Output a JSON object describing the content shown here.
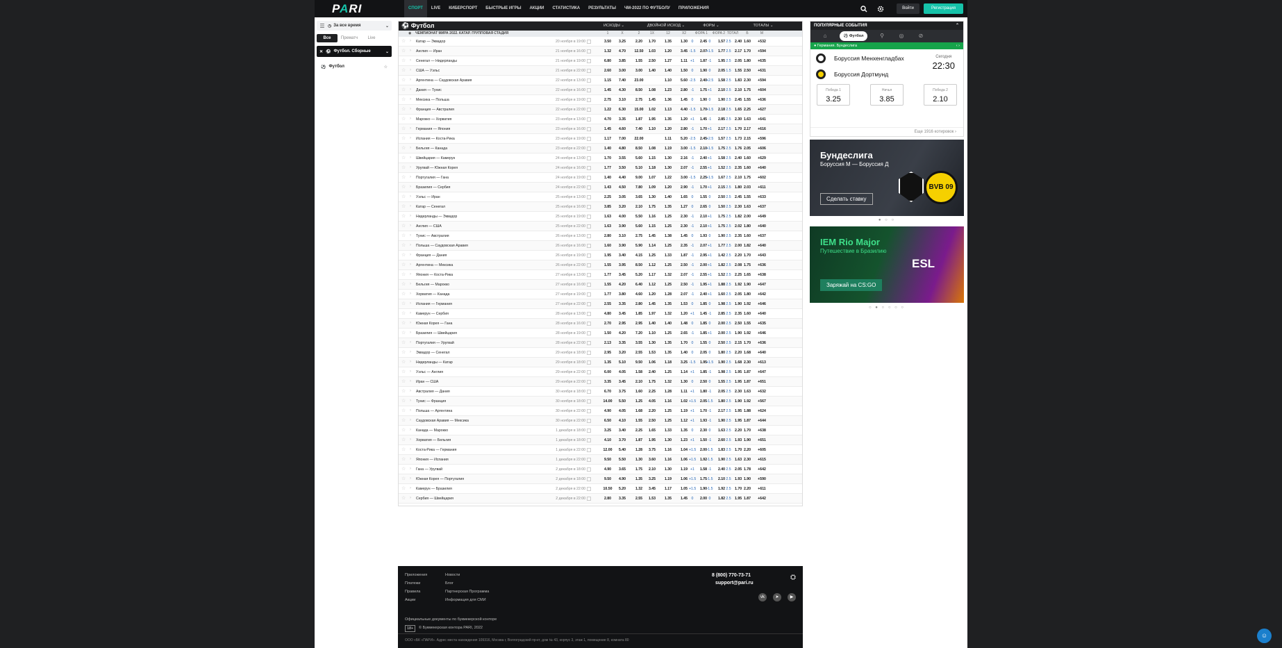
{
  "brand": {
    "logo": "PARI",
    "accent": "#16c2a9"
  },
  "nav": {
    "items": [
      "СПОРТ",
      "LIVE",
      "КИБЕРСПОРТ",
      "БЫСТРЫЕ ИГРЫ",
      "АКЦИИ",
      "СТАТИСТИКА",
      "РЕЗУЛЬТАТЫ",
      "ЧМ-2022 ПО ФУТБОЛУ",
      "ПРИЛОЖЕНИЯ"
    ],
    "login": "Войти",
    "register": "Регистрация"
  },
  "sidebar": {
    "period": "За все время",
    "tabs": [
      "Все",
      "Прематч",
      "Live"
    ],
    "filter": "Футбол. Сборные",
    "sport": "Футбол"
  },
  "main": {
    "title": "Футбол",
    "groups": [
      "ИСХОДЫ",
      "ДВОЙНОЙ ИСХОД",
      "ФОРЫ",
      "ТОТАЛЫ"
    ],
    "league": "ЧЕМПИОНАТ МИРА 2022. КАТАР. ГРУППОВАЯ СТАДИЯ",
    "columns": [
      "1",
      "X",
      "2",
      "1X",
      "12",
      "X2",
      "ФОРА 1",
      "ФОРА 2",
      "ТОТАЛ",
      "Б",
      "М"
    ],
    "matches": [
      [
        "Катар — Эквадор",
        "20 ноября в 19:00",
        "3.50",
        "3.25",
        "2.20",
        "1.70",
        "1.35",
        "1.30",
        "0",
        "2.45",
        "0",
        "1.57",
        "2.5",
        "2.40",
        "1.60",
        "+532"
      ],
      [
        "Англия — Иран",
        "21 ноября в 16:00",
        "1.32",
        "4.70",
        "12.50",
        "1.03",
        "1.20",
        "3.45",
        "-1.5",
        "2.07",
        "+1.5",
        "1.77",
        "2.5",
        "2.17",
        "1.70",
        "+594"
      ],
      [
        "Сенегал — Нидерланды",
        "21 ноября в 19:00",
        "6.80",
        "3.85",
        "1.55",
        "2.50",
        "1.27",
        "1.11",
        "+1",
        "1.87",
        "-1",
        "1.95",
        "2.5",
        "2.05",
        "1.80",
        "+635"
      ],
      [
        "США — Уэльс",
        "21 ноября в 22:00",
        "2.60",
        "3.00",
        "3.00",
        "1.40",
        "1.40",
        "1.50",
        "0",
        "1.90",
        "0",
        "2.05",
        "1.5",
        "1.55",
        "2.50",
        "+631"
      ],
      [
        "Аргентина — Саудовская Аравия",
        "22 ноября в 13:00",
        "1.15",
        "7.40",
        "23.00",
        "",
        "1.10",
        "5.60",
        "-2.5",
        "2.40",
        "+2.5",
        "1.58",
        "2.5",
        "1.83",
        "2.30",
        "+594"
      ],
      [
        "Дания — Тунис",
        "22 ноября в 16:00",
        "1.45",
        "4.30",
        "8.50",
        "1.08",
        "1.23",
        "2.80",
        "-1",
        "1.75",
        "+1",
        "2.10",
        "2.5",
        "2.10",
        "1.75",
        "+604"
      ],
      [
        "Мексика — Польша",
        "22 ноября в 19:00",
        "2.75",
        "3.10",
        "2.75",
        "1.45",
        "1.36",
        "1.45",
        "0",
        "1.90",
        "0",
        "1.90",
        "2.5",
        "2.45",
        "1.55",
        "+636"
      ],
      [
        "Франция — Австралия",
        "22 ноября в 22:00",
        "1.22",
        "6.30",
        "15.00",
        "1.02",
        "1.13",
        "4.40",
        "-1.5",
        "1.70",
        "+1.5",
        "2.18",
        "2.5",
        "1.65",
        "2.25",
        "+627"
      ],
      [
        "Марокко — Хорватия",
        "23 ноября в 13:00",
        "4.70",
        "3.35",
        "1.87",
        "1.95",
        "1.35",
        "1.20",
        "+1",
        "1.45",
        "-1",
        "2.85",
        "2.5",
        "2.30",
        "1.63",
        "+641"
      ],
      [
        "Германия — Япония",
        "23 ноября в 16:00",
        "1.45",
        "4.60",
        "7.40",
        "1.10",
        "1.20",
        "2.80",
        "-1",
        "1.70",
        "+1",
        "2.17",
        "2.5",
        "1.70",
        "2.17",
        "+616"
      ],
      [
        "Испания — Коста-Рика",
        "23 ноября в 19:00",
        "1.17",
        "7.00",
        "22.00",
        "",
        "1.11",
        "5.20",
        "-2.5",
        "2.45",
        "+2.5",
        "1.57",
        "2.5",
        "1.73",
        "2.15",
        "+596"
      ],
      [
        "Бельгия — Канада",
        "23 ноября в 22:00",
        "1.40",
        "4.80",
        "8.50",
        "1.08",
        "1.19",
        "3.00",
        "-1.5",
        "2.10",
        "+1.5",
        "1.75",
        "2.5",
        "1.76",
        "2.05",
        "+606"
      ],
      [
        "Швейцария — Камерун",
        "24 ноября в 13:00",
        "1.70",
        "3.55",
        "5.60",
        "1.15",
        "1.30",
        "2.16",
        "-1",
        "2.40",
        "+1",
        "1.58",
        "2.5",
        "2.40",
        "1.60",
        "+629"
      ],
      [
        "Уругвай — Южная Корея",
        "24 ноября в 16:00",
        "1.77",
        "3.50",
        "5.10",
        "1.18",
        "1.30",
        "2.07",
        "-1",
        "2.55",
        "+1",
        "1.52",
        "2.5",
        "2.35",
        "1.60",
        "+640"
      ],
      [
        "Португалия — Гана",
        "24 ноября в 19:00",
        "1.40",
        "4.40",
        "9.00",
        "1.07",
        "1.22",
        "3.00",
        "-1.5",
        "2.25",
        "+1.5",
        "1.67",
        "2.5",
        "2.10",
        "1.75",
        "+602"
      ],
      [
        "Бразилия — Сербия",
        "24 ноября в 22:00",
        "1.43",
        "4.50",
        "7.80",
        "1.09",
        "1.20",
        "2.90",
        "-1",
        "1.70",
        "+1",
        "2.15",
        "2.5",
        "1.80",
        "2.03",
        "+611"
      ],
      [
        "Уэльс — Иран",
        "25 ноября в 13:00",
        "2.25",
        "3.05",
        "3.65",
        "1.30",
        "1.40",
        "1.65",
        "0",
        "1.55",
        "0",
        "2.50",
        "2.5",
        "2.45",
        "1.55",
        "+633"
      ],
      [
        "Катар — Сенегал",
        "25 ноября в 16:00",
        "3.85",
        "3.20",
        "2.10",
        "1.75",
        "1.35",
        "1.27",
        "0",
        "2.65",
        "0",
        "1.50",
        "2.5",
        "2.30",
        "1.63",
        "+637"
      ],
      [
        "Нидерланды — Эквадор",
        "25 ноября в 19:00",
        "1.63",
        "4.00",
        "5.50",
        "1.16",
        "1.25",
        "2.30",
        "-1",
        "2.10",
        "+1",
        "1.75",
        "2.5",
        "1.82",
        "2.00",
        "+649"
      ],
      [
        "Англия — США",
        "25 ноября в 22:00",
        "1.63",
        "3.90",
        "5.60",
        "1.15",
        "1.25",
        "2.30",
        "-1",
        "2.10",
        "+1",
        "1.75",
        "2.5",
        "2.02",
        "1.80",
        "+640"
      ],
      [
        "Тунис — Австралия",
        "26 ноября в 13:00",
        "2.80",
        "3.10",
        "2.75",
        "1.45",
        "1.38",
        "1.45",
        "0",
        "1.93",
        "0",
        "1.90",
        "2.5",
        "2.35",
        "1.60",
        "+637"
      ],
      [
        "Польша — Саудовская Аравия",
        "26 ноября в 16:00",
        "1.60",
        "3.90",
        "5.90",
        "1.14",
        "1.25",
        "2.35",
        "-1",
        "2.07",
        "+1",
        "1.77",
        "2.5",
        "2.00",
        "1.82",
        "+640"
      ],
      [
        "Франция — Дания",
        "26 ноября в 19:00",
        "1.95",
        "3.40",
        "4.15",
        "1.25",
        "1.33",
        "1.87",
        "-1",
        "2.95",
        "+1",
        "1.42",
        "2.5",
        "2.20",
        "1.70",
        "+643"
      ],
      [
        "Аргентина — Мексика",
        "26 ноября в 22:00",
        "1.55",
        "3.95",
        "8.50",
        "1.12",
        "1.25",
        "2.50",
        "-1",
        "2.00",
        "+1",
        "1.82",
        "2.5",
        "2.08",
        "1.75",
        "+636"
      ],
      [
        "Япония — Коста-Рика",
        "27 ноября в 13:00",
        "1.77",
        "3.45",
        "5.20",
        "1.17",
        "1.32",
        "2.07",
        "-1",
        "2.55",
        "+1",
        "1.52",
        "2.5",
        "2.25",
        "1.65",
        "+638"
      ],
      [
        "Бельгия — Марокко",
        "27 ноября в 16:00",
        "1.55",
        "4.20",
        "6.40",
        "1.12",
        "1.25",
        "2.50",
        "-1",
        "1.95",
        "+1",
        "1.88",
        "2.5",
        "1.92",
        "1.90",
        "+647"
      ],
      [
        "Хорватия — Канада",
        "27 ноября в 19:00",
        "1.77",
        "3.80",
        "4.60",
        "1.20",
        "1.28",
        "2.07",
        "-1",
        "2.40",
        "+1",
        "1.60",
        "2.5",
        "2.05",
        "1.80",
        "+642"
      ],
      [
        "Испания — Германия",
        "27 ноября в 22:00",
        "2.55",
        "3.35",
        "2.80",
        "1.45",
        "1.35",
        "1.53",
        "0",
        "1.85",
        "0",
        "1.98",
        "2.5",
        "1.90",
        "1.92",
        "+646"
      ],
      [
        "Камерун — Сербия",
        "28 ноября в 13:00",
        "4.80",
        "3.45",
        "1.85",
        "1.97",
        "1.32",
        "1.20",
        "+1",
        "1.45",
        "-1",
        "2.85",
        "2.5",
        "2.35",
        "1.60",
        "+640"
      ],
      [
        "Южная Корея — Гана",
        "28 ноября в 16:00",
        "2.70",
        "2.95",
        "2.95",
        "1.40",
        "1.40",
        "1.48",
        "0",
        "1.85",
        "0",
        "2.00",
        "2.5",
        "2.50",
        "1.55",
        "+635"
      ],
      [
        "Бразилия — Швейцария",
        "28 ноября в 19:00",
        "1.50",
        "4.20",
        "7.20",
        "1.10",
        "1.25",
        "2.65",
        "-1",
        "1.85",
        "+1",
        "2.00",
        "2.5",
        "1.90",
        "1.92",
        "+646"
      ],
      [
        "Португалия — Уругвай",
        "28 ноября в 22:00",
        "2.13",
        "3.35",
        "3.55",
        "1.30",
        "1.35",
        "1.70",
        "0",
        "1.55",
        "0",
        "2.50",
        "2.5",
        "2.15",
        "1.70",
        "+636"
      ],
      [
        "Эквадор — Сенегал",
        "29 ноября в 18:00",
        "2.95",
        "3.20",
        "2.55",
        "1.53",
        "1.35",
        "1.40",
        "0",
        "2.05",
        "0",
        "1.80",
        "2.5",
        "2.20",
        "1.68",
        "+640"
      ],
      [
        "Нидерланды — Катар",
        "29 ноября в 18:00",
        "1.35",
        "5.10",
        "9.50",
        "1.06",
        "1.18",
        "3.25",
        "-1.5",
        "1.95",
        "+1.5",
        "1.90",
        "2.5",
        "1.68",
        "2.30",
        "+613"
      ],
      [
        "Уэльс — Англия",
        "29 ноября в 22:00",
        "6.00",
        "4.05",
        "1.58",
        "2.40",
        "1.25",
        "1.14",
        "+1",
        "1.85",
        "-1",
        "1.98",
        "2.5",
        "1.95",
        "1.87",
        "+647"
      ],
      [
        "Иран — США",
        "29 ноября в 22:00",
        "3.35",
        "3.45",
        "2.10",
        "1.75",
        "1.32",
        "1.30",
        "0",
        "2.50",
        "0",
        "1.55",
        "2.5",
        "1.95",
        "1.87",
        "+651"
      ],
      [
        "Австралия — Дания",
        "30 ноября в 18:00",
        "6.70",
        "3.75",
        "1.60",
        "2.25",
        "1.28",
        "1.11",
        "+1",
        "1.80",
        "-1",
        "2.05",
        "2.5",
        "2.30",
        "1.63",
        "+632"
      ],
      [
        "Тунис — Франция",
        "30 ноября в 18:00",
        "14.00",
        "5.50",
        "1.25",
        "4.05",
        "1.16",
        "1.02",
        "+1.5",
        "2.05",
        "-1.5",
        "1.80",
        "2.5",
        "1.90",
        "1.92",
        "+567"
      ],
      [
        "Польша — Аргентина",
        "30 ноября в 22:00",
        "4.90",
        "4.05",
        "1.68",
        "2.20",
        "1.25",
        "1.19",
        "+1",
        "1.70",
        "-1",
        "2.17",
        "2.5",
        "1.95",
        "1.88",
        "+624"
      ],
      [
        "Саудовская Аравия — Мексика",
        "30 ноября в 22:00",
        "6.50",
        "4.10",
        "1.55",
        "2.50",
        "1.25",
        "1.12",
        "+1",
        "1.93",
        "-1",
        "1.90",
        "2.5",
        "1.95",
        "1.87",
        "+644"
      ],
      [
        "Канада — Марокко",
        "1 декабря в 18:00",
        "3.25",
        "3.40",
        "2.25",
        "1.65",
        "1.33",
        "1.35",
        "0",
        "2.30",
        "0",
        "1.63",
        "2.5",
        "2.20",
        "1.70",
        "+638"
      ],
      [
        "Хорватия — Бельгия",
        "1 декабря в 18:00",
        "4.10",
        "3.70",
        "1.87",
        "1.95",
        "1.30",
        "1.23",
        "+1",
        "1.50",
        "-1",
        "2.60",
        "2.5",
        "1.93",
        "1.90",
        "+651"
      ],
      [
        "Коста-Рика — Германия",
        "1 декабря в 22:00",
        "12.00",
        "5.40",
        "1.28",
        "3.75",
        "1.16",
        "1.04",
        "+1.5",
        "2.00",
        "-1.5",
        "1.83",
        "2.5",
        "1.70",
        "2.20",
        "+605"
      ],
      [
        "Япония — Испания",
        "1 декабря в 22:00",
        "9.50",
        "5.50",
        "1.30",
        "3.60",
        "1.16",
        "1.06",
        "+1.5",
        "1.92",
        "-1.5",
        "1.90",
        "2.5",
        "1.63",
        "2.30",
        "+615"
      ],
      [
        "Гана — Уругвай",
        "2 декабря в 18:00",
        "4.90",
        "3.65",
        "1.75",
        "2.10",
        "1.30",
        "1.19",
        "+1",
        "1.58",
        "-1",
        "2.40",
        "2.5",
        "2.05",
        "1.78",
        "+642"
      ],
      [
        "Южная Корея — Португалия",
        "2 декабря в 18:00",
        "9.50",
        "4.90",
        "1.35",
        "3.25",
        "1.19",
        "1.06",
        "+1.5",
        "1.75",
        "-1.5",
        "2.10",
        "2.5",
        "1.93",
        "1.90",
        "+590"
      ],
      [
        "Камерун — Бразилия",
        "2 декабря в 22:00",
        "10.50",
        "5.20",
        "1.32",
        "3.45",
        "1.17",
        "1.05",
        "+1.5",
        "1.90",
        "-1.5",
        "1.92",
        "2.5",
        "1.70",
        "2.20",
        "+611"
      ],
      [
        "Сербия — Швейцария",
        "2 декабря в 22:00",
        "2.80",
        "3.35",
        "2.55",
        "1.53",
        "1.35",
        "1.45",
        "0",
        "2.00",
        "0",
        "1.82",
        "2.5",
        "1.95",
        "1.87",
        "+642"
      ]
    ]
  },
  "popular": {
    "title": "ПОПУЛЯРНЫЕ СОБЫТИЯ",
    "selected_tab": "Футбол",
    "league": "Германия. Бундеслига",
    "team1": "Боруссия Менхенгладбах",
    "team2": "Боруссия Дортмунд",
    "day": "Сегодня",
    "time": "22:30",
    "odds": [
      {
        "label": "Победа 1",
        "value": "3.25"
      },
      {
        "label": "Ничья",
        "value": "3.85"
      },
      {
        "label": "Победа 2",
        "value": "2.10"
      }
    ],
    "more": "Еще 1916 котировок"
  },
  "promo1": {
    "title": "Бундеслига",
    "subtitle": "Боруссия М — Боруссия Д",
    "button": "Сделать ставку",
    "bvb": "BVB 09"
  },
  "promo2": {
    "title": "IEM Rio Major",
    "subtitle": "Путешествие в Бразилию",
    "button": "Заряжай на CS:GO",
    "esl": "ESL"
  },
  "footer": {
    "col1": [
      "Приложения",
      "Платежи",
      "Правила",
      "Акции"
    ],
    "col2": [
      "Новости",
      "Блог",
      "Партнерская Программа",
      "Информация для СМИ"
    ],
    "phone": "8 (800) 770-73-71",
    "email": "support@pari.ru",
    "docs": "Официальные документы по букмекерской конторе",
    "age": "18+",
    "copyright": "© Букмекерская контора PARI, 2022",
    "address": "ООО «БК «ПАРИ». Адрес места нахождения 109316, Москва г, Волгоградский пр-кт, дом № 43, корпус 3, этаж 1, помещение 8, комната 80"
  }
}
